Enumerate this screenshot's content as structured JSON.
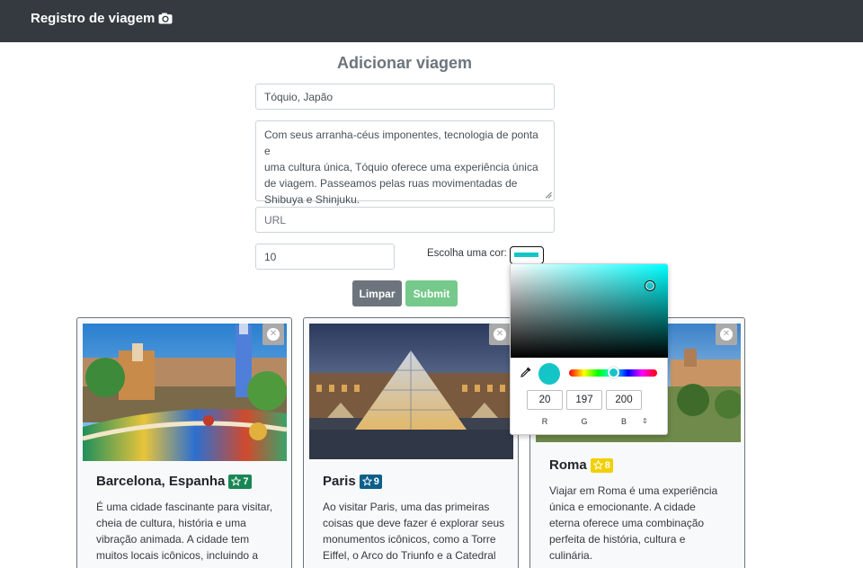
{
  "navbar": {
    "brand": "Registro de viagem",
    "brand_icon": "camera-icon"
  },
  "form": {
    "title": "Adicionar viagem",
    "title_field_value": "Tóquio, Japão",
    "description_lines": [
      "Com seus arranha-céus imponentes, tecnologia de ponta e",
      "uma cultura única, Tóquio oferece uma experiência única",
      "de viagem. Passeamos pelas ruas movimentadas de",
      "Shibuya e Shinjuku."
    ],
    "url_placeholder": "URL",
    "rating_value": "10",
    "color_label": "Escolha uma cor:",
    "color_value": "#14c5c8",
    "clear_label": "Limpar",
    "submit_label": "Submit"
  },
  "color_picker": {
    "r": "20",
    "g": "197",
    "b": "200",
    "r_label": "R",
    "g_label": "G",
    "b_label": "B",
    "toggle_icon": "⇕"
  },
  "cards": [
    {
      "title": "Barcelona, Espanha",
      "rating": "7",
      "badge_color": "#198754",
      "lines": [
        "É uma cidade fascinante para visitar,",
        "cheia de cultura, história e uma",
        "vibração animada. A cidade tem",
        "muitos locais icônicos, incluindo a"
      ]
    },
    {
      "title": "Paris",
      "rating": "9",
      "badge_color": "#0d5f8a",
      "lines": [
        "Ao visitar Paris, uma das primeiras",
        "coisas que deve fazer é explorar seus",
        "monumentos icônicos, como a Torre",
        "Eiffel, o Arco do Triunfo e a Catedral"
      ]
    },
    {
      "title": "Roma",
      "rating": "8",
      "badge_color": "#f0d000",
      "lines": [
        "Viajar em Roma é uma experiência",
        "única e emocionante. A cidade",
        "eterna oferece uma combinação",
        "perfeita de história, cultura e",
        "culinária."
      ]
    }
  ]
}
